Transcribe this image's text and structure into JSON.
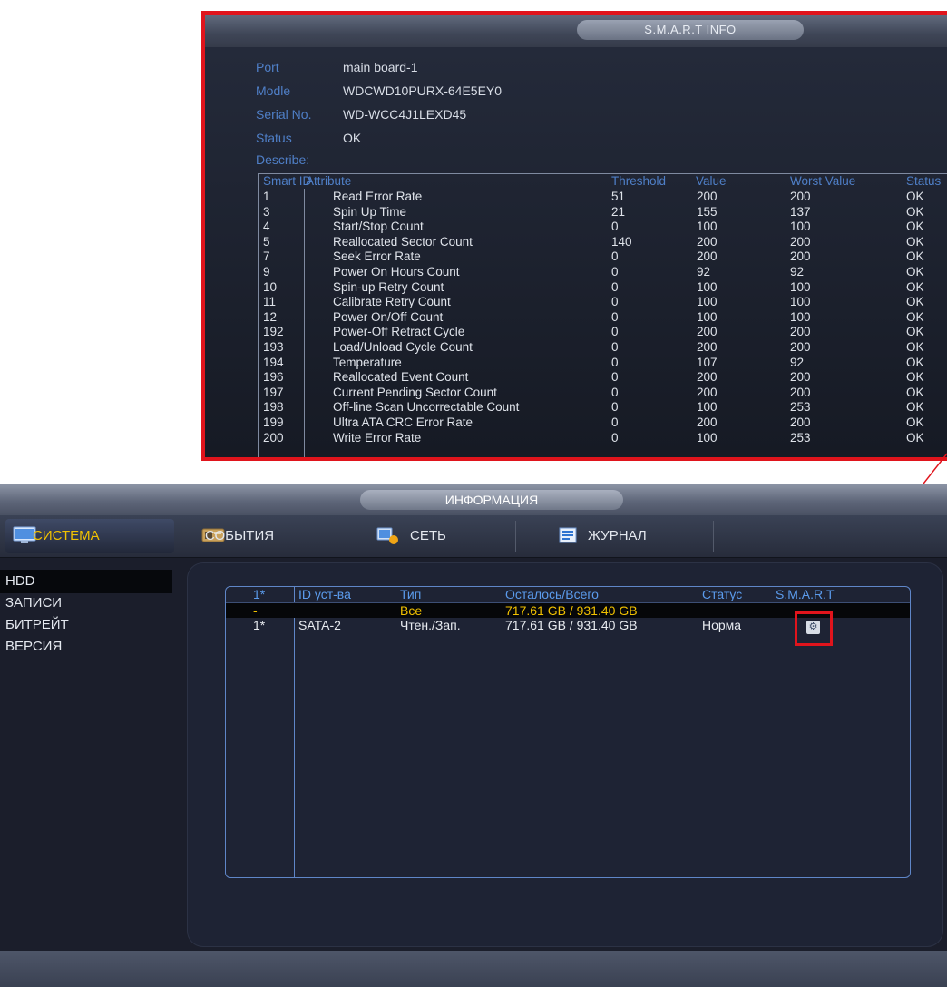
{
  "smart_popup": {
    "title": "S.M.A.R.T INFO",
    "info": [
      {
        "label": "Port",
        "value": "main board-1"
      },
      {
        "label": "Modle",
        "value": "WDCWD10PURX-64E5EY0"
      },
      {
        "label": "Serial No.",
        "value": "WD-WCC4J1LEXD45"
      },
      {
        "label": "Status",
        "value": "OK"
      },
      {
        "label": "Describe:",
        "value": ""
      }
    ],
    "table": {
      "headers": {
        "id": "Smart ID",
        "attribute": "Attribute",
        "threshold": "Threshold",
        "value": "Value",
        "worst": "Worst Value",
        "status": "Status"
      },
      "rows": [
        {
          "id": "1",
          "attribute": "Read Error Rate",
          "threshold": "51",
          "value": "200",
          "worst": "200",
          "status": "OK"
        },
        {
          "id": "3",
          "attribute": "Spin Up Time",
          "threshold": "21",
          "value": "155",
          "worst": "137",
          "status": "OK"
        },
        {
          "id": "4",
          "attribute": "Start/Stop Count",
          "threshold": "0",
          "value": "100",
          "worst": "100",
          "status": "OK"
        },
        {
          "id": "5",
          "attribute": "Reallocated Sector Count",
          "threshold": "140",
          "value": "200",
          "worst": "200",
          "status": "OK"
        },
        {
          "id": "7",
          "attribute": "Seek Error Rate",
          "threshold": "0",
          "value": "200",
          "worst": "200",
          "status": "OK"
        },
        {
          "id": "9",
          "attribute": "Power On Hours Count",
          "threshold": "0",
          "value": "92",
          "worst": "92",
          "status": "OK"
        },
        {
          "id": "10",
          "attribute": "Spin-up Retry Count",
          "threshold": "0",
          "value": "100",
          "worst": "100",
          "status": "OK"
        },
        {
          "id": "11",
          "attribute": "Calibrate Retry Count",
          "threshold": "0",
          "value": "100",
          "worst": "100",
          "status": "OK"
        },
        {
          "id": "12",
          "attribute": "Power On/Off Count",
          "threshold": "0",
          "value": "100",
          "worst": "100",
          "status": "OK"
        },
        {
          "id": "192",
          "attribute": "Power-Off Retract Cycle",
          "threshold": "0",
          "value": "200",
          "worst": "200",
          "status": "OK"
        },
        {
          "id": "193",
          "attribute": "Load/Unload Cycle Count",
          "threshold": "0",
          "value": "200",
          "worst": "200",
          "status": "OK"
        },
        {
          "id": "194",
          "attribute": "Temperature",
          "threshold": "0",
          "value": "107",
          "worst": "92",
          "status": "OK"
        },
        {
          "id": "196",
          "attribute": "Reallocated Event Count",
          "threshold": "0",
          "value": "200",
          "worst": "200",
          "status": "OK"
        },
        {
          "id": "197",
          "attribute": "Current Pending Sector Count",
          "threshold": "0",
          "value": "200",
          "worst": "200",
          "status": "OK"
        },
        {
          "id": "198",
          "attribute": "Off-line Scan Uncorrectable Count",
          "threshold": "0",
          "value": "100",
          "worst": "253",
          "status": "OK"
        },
        {
          "id": "199",
          "attribute": "Ultra ATA CRC Error Rate",
          "threshold": "0",
          "value": "200",
          "worst": "200",
          "status": "OK"
        },
        {
          "id": "200",
          "attribute": "Write Error Rate",
          "threshold": "0",
          "value": "100",
          "worst": "253",
          "status": "OK"
        }
      ]
    }
  },
  "main_window": {
    "title": "ИНФОРМАЦИЯ",
    "tabs": [
      {
        "label": "СИСТЕМА",
        "icon": "monitor-icon"
      },
      {
        "label": "СОБЫТИЯ",
        "icon": "camera-event-icon"
      },
      {
        "label": "СЕТЬ",
        "icon": "network-icon"
      },
      {
        "label": "ЖУРНАЛ",
        "icon": "log-icon"
      }
    ],
    "sidebar": [
      "HDD",
      "ЗАПИСИ",
      "БИТРЕЙТ",
      "ВЕРСИЯ"
    ],
    "hdd_table": {
      "headers": {
        "num": "1*",
        "id": "ID уст-ва",
        "type": "Тип",
        "capacity": "Осталось/Всего",
        "status": "Статус",
        "smart": "S.M.A.R.T"
      },
      "rows": [
        {
          "num": "-",
          "id": "",
          "type": "Все",
          "capacity": "717.61 GB / 931.40 GB",
          "status": ""
        },
        {
          "num": "1*",
          "id": "SATA-2",
          "type": "Чтен./Зап.",
          "capacity": "717.61 GB / 931.40 GB",
          "status": "Норма"
        }
      ]
    }
  },
  "colors": {
    "highlight_red": "#e0141c",
    "label_blue": "#4f7fc7",
    "active_yellow": "#f2c200"
  }
}
